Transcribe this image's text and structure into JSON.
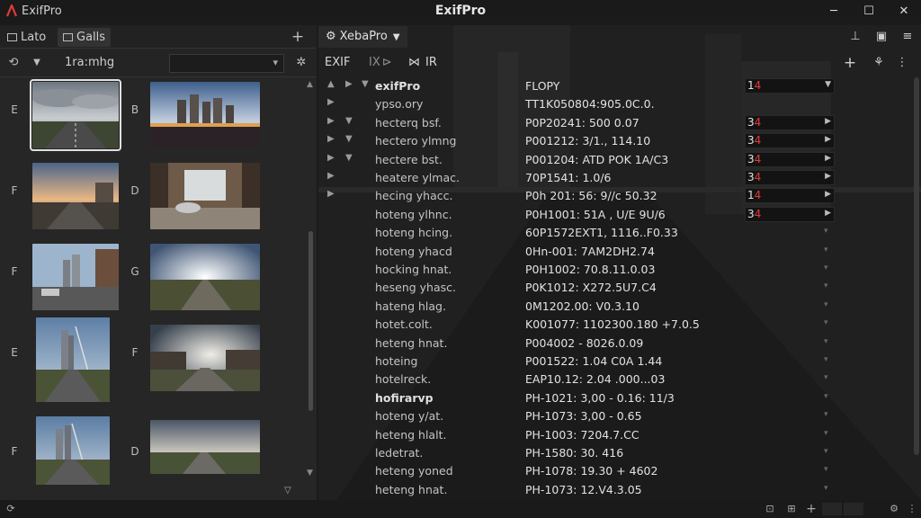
{
  "window": {
    "app_name": "ExifPro",
    "title": "ExifPro",
    "minimize": "─",
    "maximize": "☐",
    "close": "✕"
  },
  "left_tabs": [
    {
      "label": "Lato"
    },
    {
      "label": "Galls"
    }
  ],
  "left_toolbar": {
    "label": "1ra:mhg",
    "select_value": ""
  },
  "thumb_rows": [
    {
      "left_letter": "E",
      "mid_letter": "B"
    },
    {
      "left_letter": "F",
      "mid_letter": "D"
    },
    {
      "left_letter": "F",
      "mid_letter": "G"
    },
    {
      "left_letter": "E",
      "mid_letter": "F"
    },
    {
      "left_letter": "F",
      "mid_letter": "D"
    }
  ],
  "right_tab": {
    "label": "XebaPro"
  },
  "right_toolbar": {
    "exif_label": "EXIF",
    "ix_label": "IX",
    "ir_label": "IR"
  },
  "exif_rows": [
    {
      "key": "exifPro",
      "value": "FLOPY",
      "bold": true,
      "box": "14",
      "tri": 3
    },
    {
      "key": "ypso.ory",
      "value": "TT1K050804:905.0C.0.",
      "tri": 1
    },
    {
      "key": "hecterq bsf.",
      "value": "P0P20241: 500 0.07",
      "tri": 2,
      "box": "34"
    },
    {
      "key": "hectero ylmng",
      "value": "P001212: 3/1., 114.10",
      "tri": 2,
      "box": "34"
    },
    {
      "key": "hectere bst.",
      "value": "P001204: ATD POK 1A/C3",
      "tri": 2,
      "box": "34"
    },
    {
      "key": "heatere ylmac.",
      "value": "70P1541: 1.0/6",
      "tri": 1,
      "box": "34"
    },
    {
      "key": "hecing yhacc.",
      "value": "P0h 201: 56: 9//c 50.32",
      "tri": 1,
      "box": "14"
    },
    {
      "key": "hoteng ylhnc.",
      "value": "P0H1001: 51A , U/E 9U/6",
      "box": "34"
    },
    {
      "key": "hoteng hcing.",
      "value": "60P1572EXT1, 1116..F0.33"
    },
    {
      "key": "hoteng yhacd",
      "value": "0Hn-001: 7AM2DH2.74"
    },
    {
      "key": "hocking hnat.",
      "value": "P0H1002: 70.8.11.0.03"
    },
    {
      "key": "heseng yhasc.",
      "value": "P0K1012: X272.5U7.C4"
    },
    {
      "key": "hateng hlag.",
      "value": "0M1202.00: V0.3.10"
    },
    {
      "key": "hotet.colt.",
      "value": "K001077: 1102300.180 +7.0.5"
    },
    {
      "key": "heteng hnat.",
      "value": "P004002 - 8026.0.09"
    },
    {
      "key": "hoteing",
      "value": "P001522: 1.04 C0A 1.44"
    },
    {
      "key": "hotelreck.",
      "value": "EAP10.12: 2.04 .000...03"
    },
    {
      "key": "hofirarvp",
      "value": "PH-1021: 3,00 - 0.16: 11/3",
      "bold": true
    },
    {
      "key": "hoteng y/at.",
      "value": "PH-1073: 3,00 - 0.65"
    },
    {
      "key": "heteng hlalt.",
      "value": "PH-1003: 7204.7.CC"
    },
    {
      "key": "ledetrat.",
      "value": "PH-1580: 30. 416"
    },
    {
      "key": "heteng yoned",
      "value": "PH-1078: 19.30 + 4602"
    },
    {
      "key": "heteng hnat.",
      "value": "PH-1073: 12.V4.3.05"
    }
  ],
  "colors": {
    "accent_red": "#e23a3a",
    "panel": "#262626",
    "background": "#1b1b1b"
  }
}
